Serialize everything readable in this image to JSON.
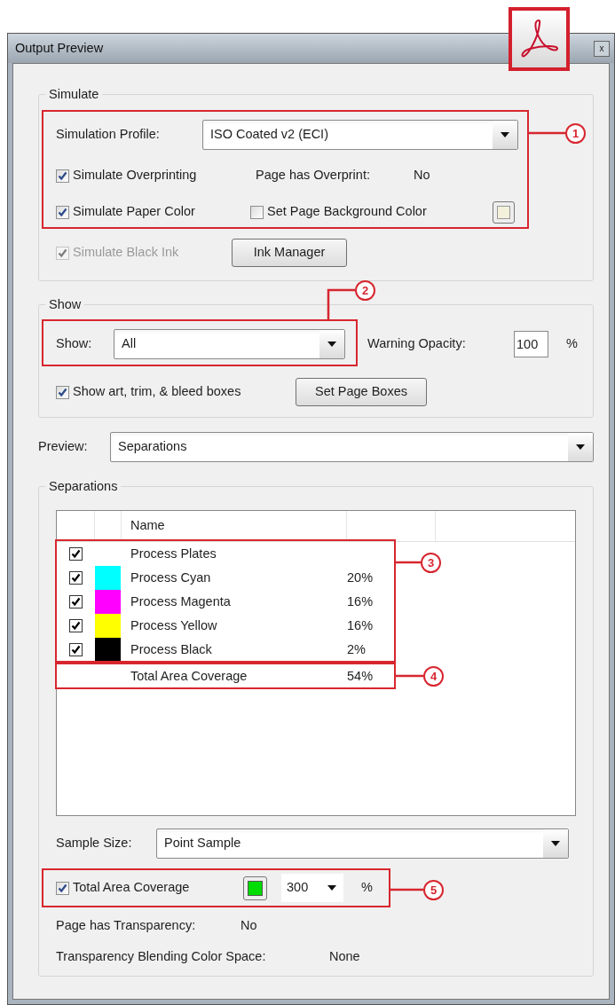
{
  "window": {
    "title": "Output Preview",
    "close_label": "x"
  },
  "simulate": {
    "title": "Simulate",
    "profile_label": "Simulation Profile:",
    "profile_value": "ISO Coated v2 (ECI)",
    "overprinting": {
      "label": "Simulate Overprinting",
      "checked": true
    },
    "overprint_info": {
      "label": "Page has Overprint:",
      "value": "No"
    },
    "paper_color": {
      "label": "Simulate Paper Color",
      "checked": true
    },
    "page_background": {
      "label": "Set Page Background Color",
      "checked": false
    },
    "black_ink": {
      "label": "Simulate Black Ink",
      "checked": true,
      "disabled": true
    },
    "ink_manager_button": "Ink Manager"
  },
  "show": {
    "title": "Show",
    "show_label": "Show:",
    "show_value": "All",
    "opacity_label": "Warning Opacity:",
    "opacity_value": "100",
    "opacity_unit": "%",
    "page_boxes": {
      "label": "Show art, trim, & bleed boxes",
      "checked": true
    },
    "set_page_boxes_button": "Set Page Boxes"
  },
  "preview": {
    "label": "Preview:",
    "value": "Separations"
  },
  "separations": {
    "title": "Separations",
    "columns": [
      "Name"
    ],
    "rows": [
      {
        "name": "Process Plates",
        "checked": true
      },
      {
        "name": "Process Cyan",
        "coverage": "20%",
        "checked": true,
        "color": "#00ffff"
      },
      {
        "name": "Process Magenta",
        "coverage": "16%",
        "checked": true,
        "color": "#ff00ff"
      },
      {
        "name": "Process Yellow",
        "coverage": "16%",
        "checked": true,
        "color": "#ffff00"
      },
      {
        "name": "Process Black",
        "coverage": "2%",
        "checked": true,
        "color": "#000000"
      }
    ],
    "total": {
      "name": "Total Area Coverage",
      "coverage": "54%"
    },
    "sample_size": {
      "label": "Sample Size:",
      "value": "Point Sample"
    },
    "total_area_coverage": {
      "label": "Total Area Coverage",
      "checked": true,
      "color": "#00dd00",
      "value": "300",
      "unit": "%"
    },
    "transparency": {
      "label": "Page has Transparency:",
      "value": "No"
    },
    "blending": {
      "label": "Transparency Blending Color Space:",
      "value": "None"
    }
  },
  "callouts": [
    {
      "number": "1"
    },
    {
      "number": "2"
    },
    {
      "number": "3"
    },
    {
      "number": "4"
    },
    {
      "number": "5"
    }
  ]
}
